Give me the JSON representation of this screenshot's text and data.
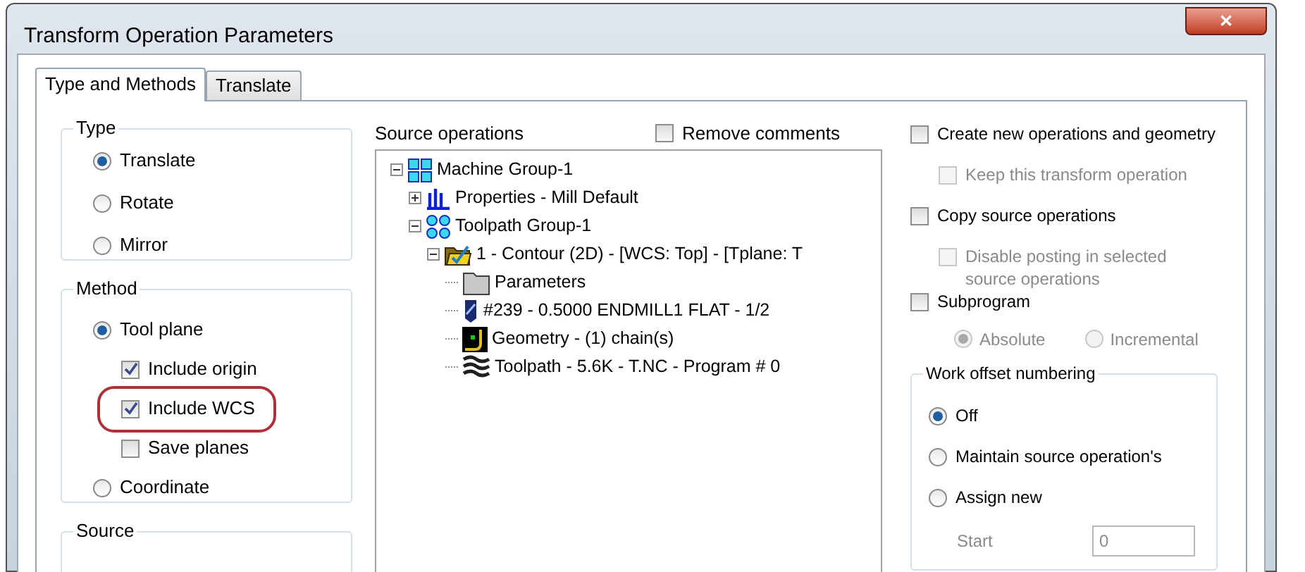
{
  "window": {
    "title": "Transform Operation Parameters",
    "close": "✕"
  },
  "tabs": [
    {
      "label": "Type and Methods",
      "selected": true
    },
    {
      "label": "Translate",
      "selected": false
    }
  ],
  "type_group": {
    "title": "Type",
    "options": [
      {
        "label": "Translate",
        "selected": true
      },
      {
        "label": "Rotate",
        "selected": false
      },
      {
        "label": "Mirror",
        "selected": false
      }
    ]
  },
  "method_group": {
    "title": "Method",
    "items": [
      {
        "kind": "radio",
        "label": "Tool plane",
        "selected": true,
        "highlighted": false
      },
      {
        "kind": "checkbox",
        "label": "Include origin",
        "checked": true,
        "highlighted": false
      },
      {
        "kind": "checkbox",
        "label": "Include WCS",
        "checked": true,
        "highlighted": true
      },
      {
        "kind": "checkbox",
        "label": "Save planes",
        "checked": false,
        "highlighted": false
      },
      {
        "kind": "radio",
        "label": "Coordinate",
        "selected": false,
        "highlighted": false
      }
    ]
  },
  "source_group": {
    "title": "Source"
  },
  "source_operations": {
    "label": "Source operations",
    "remove_comments": {
      "label": "Remove comments",
      "checked": false
    },
    "tree": [
      {
        "label": "Machine Group-1",
        "kind": "machine",
        "expanded": true,
        "children": [
          {
            "label": "Properties - Mill Default",
            "kind": "properties",
            "expanded": false
          },
          {
            "label": "Toolpath Group-1",
            "kind": "toolpath-group",
            "expanded": true,
            "children": [
              {
                "label": "1 - Contour (2D) - [WCS: Top] - [Tplane: T",
                "kind": "operation",
                "expanded": true,
                "children": [
                  {
                    "label": "Parameters",
                    "kind": "folder"
                  },
                  {
                    "label": "#239 - 0.5000 ENDMILL1 FLAT -  1/2",
                    "kind": "tool"
                  },
                  {
                    "label": "Geometry - (1) chain(s)",
                    "kind": "geometry"
                  },
                  {
                    "label": "Toolpath - 5.6K - T.NC - Program # 0",
                    "kind": "toolpath"
                  }
                ]
              }
            ]
          }
        ]
      }
    ]
  },
  "options": [
    {
      "label": "Create new operations and geometry",
      "checked": false,
      "disabled": false,
      "indented": false
    },
    {
      "label": "Keep this transform operation",
      "checked": false,
      "disabled": true,
      "indented": true
    },
    {
      "label": "Copy source operations",
      "checked": false,
      "disabled": false,
      "indented": false
    },
    {
      "label": "Disable posting in selected source operations",
      "checked": false,
      "disabled": true,
      "indented": true
    },
    {
      "label": "Subprogram",
      "checked": false,
      "disabled": false,
      "indented": false
    }
  ],
  "subprogram_modes": [
    {
      "label": "Absolute",
      "selected": true,
      "disabled": true
    },
    {
      "label": "Incremental",
      "selected": false,
      "disabled": true
    }
  ],
  "work_offset": {
    "title": "Work offset numbering",
    "options": [
      {
        "label": "Off",
        "selected": true
      },
      {
        "label": "Maintain source operation's",
        "selected": false
      },
      {
        "label": "Assign new",
        "selected": false
      }
    ],
    "start": {
      "label": "Start",
      "value": "0",
      "disabled": true
    }
  }
}
